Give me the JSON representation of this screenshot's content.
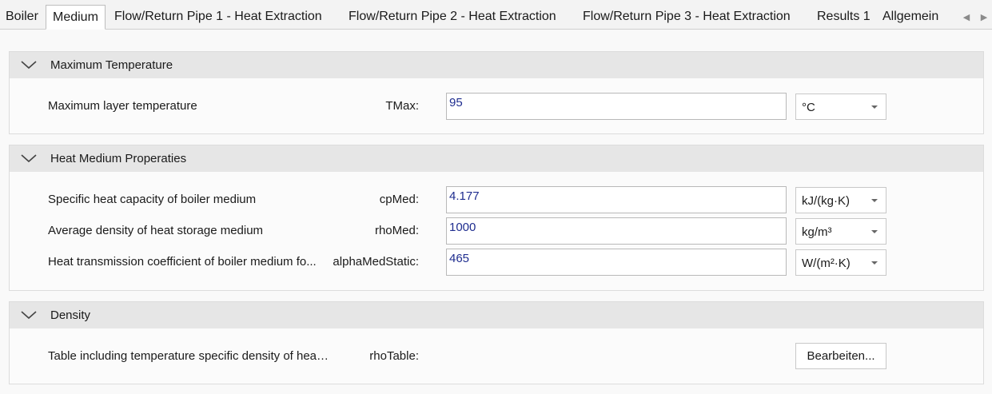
{
  "tabs": [
    {
      "label": "Boiler",
      "active": false
    },
    {
      "label": "Medium",
      "active": true
    },
    {
      "label": "Flow/Return Pipe 1 - Heat Extraction",
      "active": false
    },
    {
      "label": "Flow/Return Pipe 2 - Heat Extraction",
      "active": false
    },
    {
      "label": "Flow/Return Pipe 3 - Heat Extraction",
      "active": false
    },
    {
      "label": "Results 1",
      "active": false
    },
    {
      "label": "Allgemein",
      "active": false
    }
  ],
  "tab_scroll": {
    "left_icon": "chevron-left-icon",
    "right_icon": "chevron-right-icon"
  },
  "groups": {
    "max_temp": {
      "title": "Maximum Temperature",
      "rows": [
        {
          "description": "Maximum layer temperature",
          "param": "TMax:",
          "value": "95",
          "unit": "°C"
        }
      ]
    },
    "heat_medium": {
      "title": "Heat Medium Properaties",
      "rows": [
        {
          "description": "Specific heat capacity of boiler medium",
          "param": "cpMed:",
          "value": "4.177",
          "unit": "kJ/(kg·K)"
        },
        {
          "description": "Average density of heat storage medium",
          "param": "rhoMed:",
          "value": "1000",
          "unit": "kg/m³"
        },
        {
          "description": "Heat transmission coefficient of boiler medium fo...",
          "param": "alphaMedStatic:",
          "value": "465",
          "unit": "W/(m²·K)"
        }
      ]
    },
    "density": {
      "title": "Density",
      "rows": [
        {
          "description": "Table including temperature specific density of heat med...",
          "param": "rhoTable:",
          "button": "Bearbeiten..."
        }
      ]
    }
  },
  "colors": {
    "value_text": "#1f2d8f",
    "header_bg": "#e6e6e6"
  }
}
